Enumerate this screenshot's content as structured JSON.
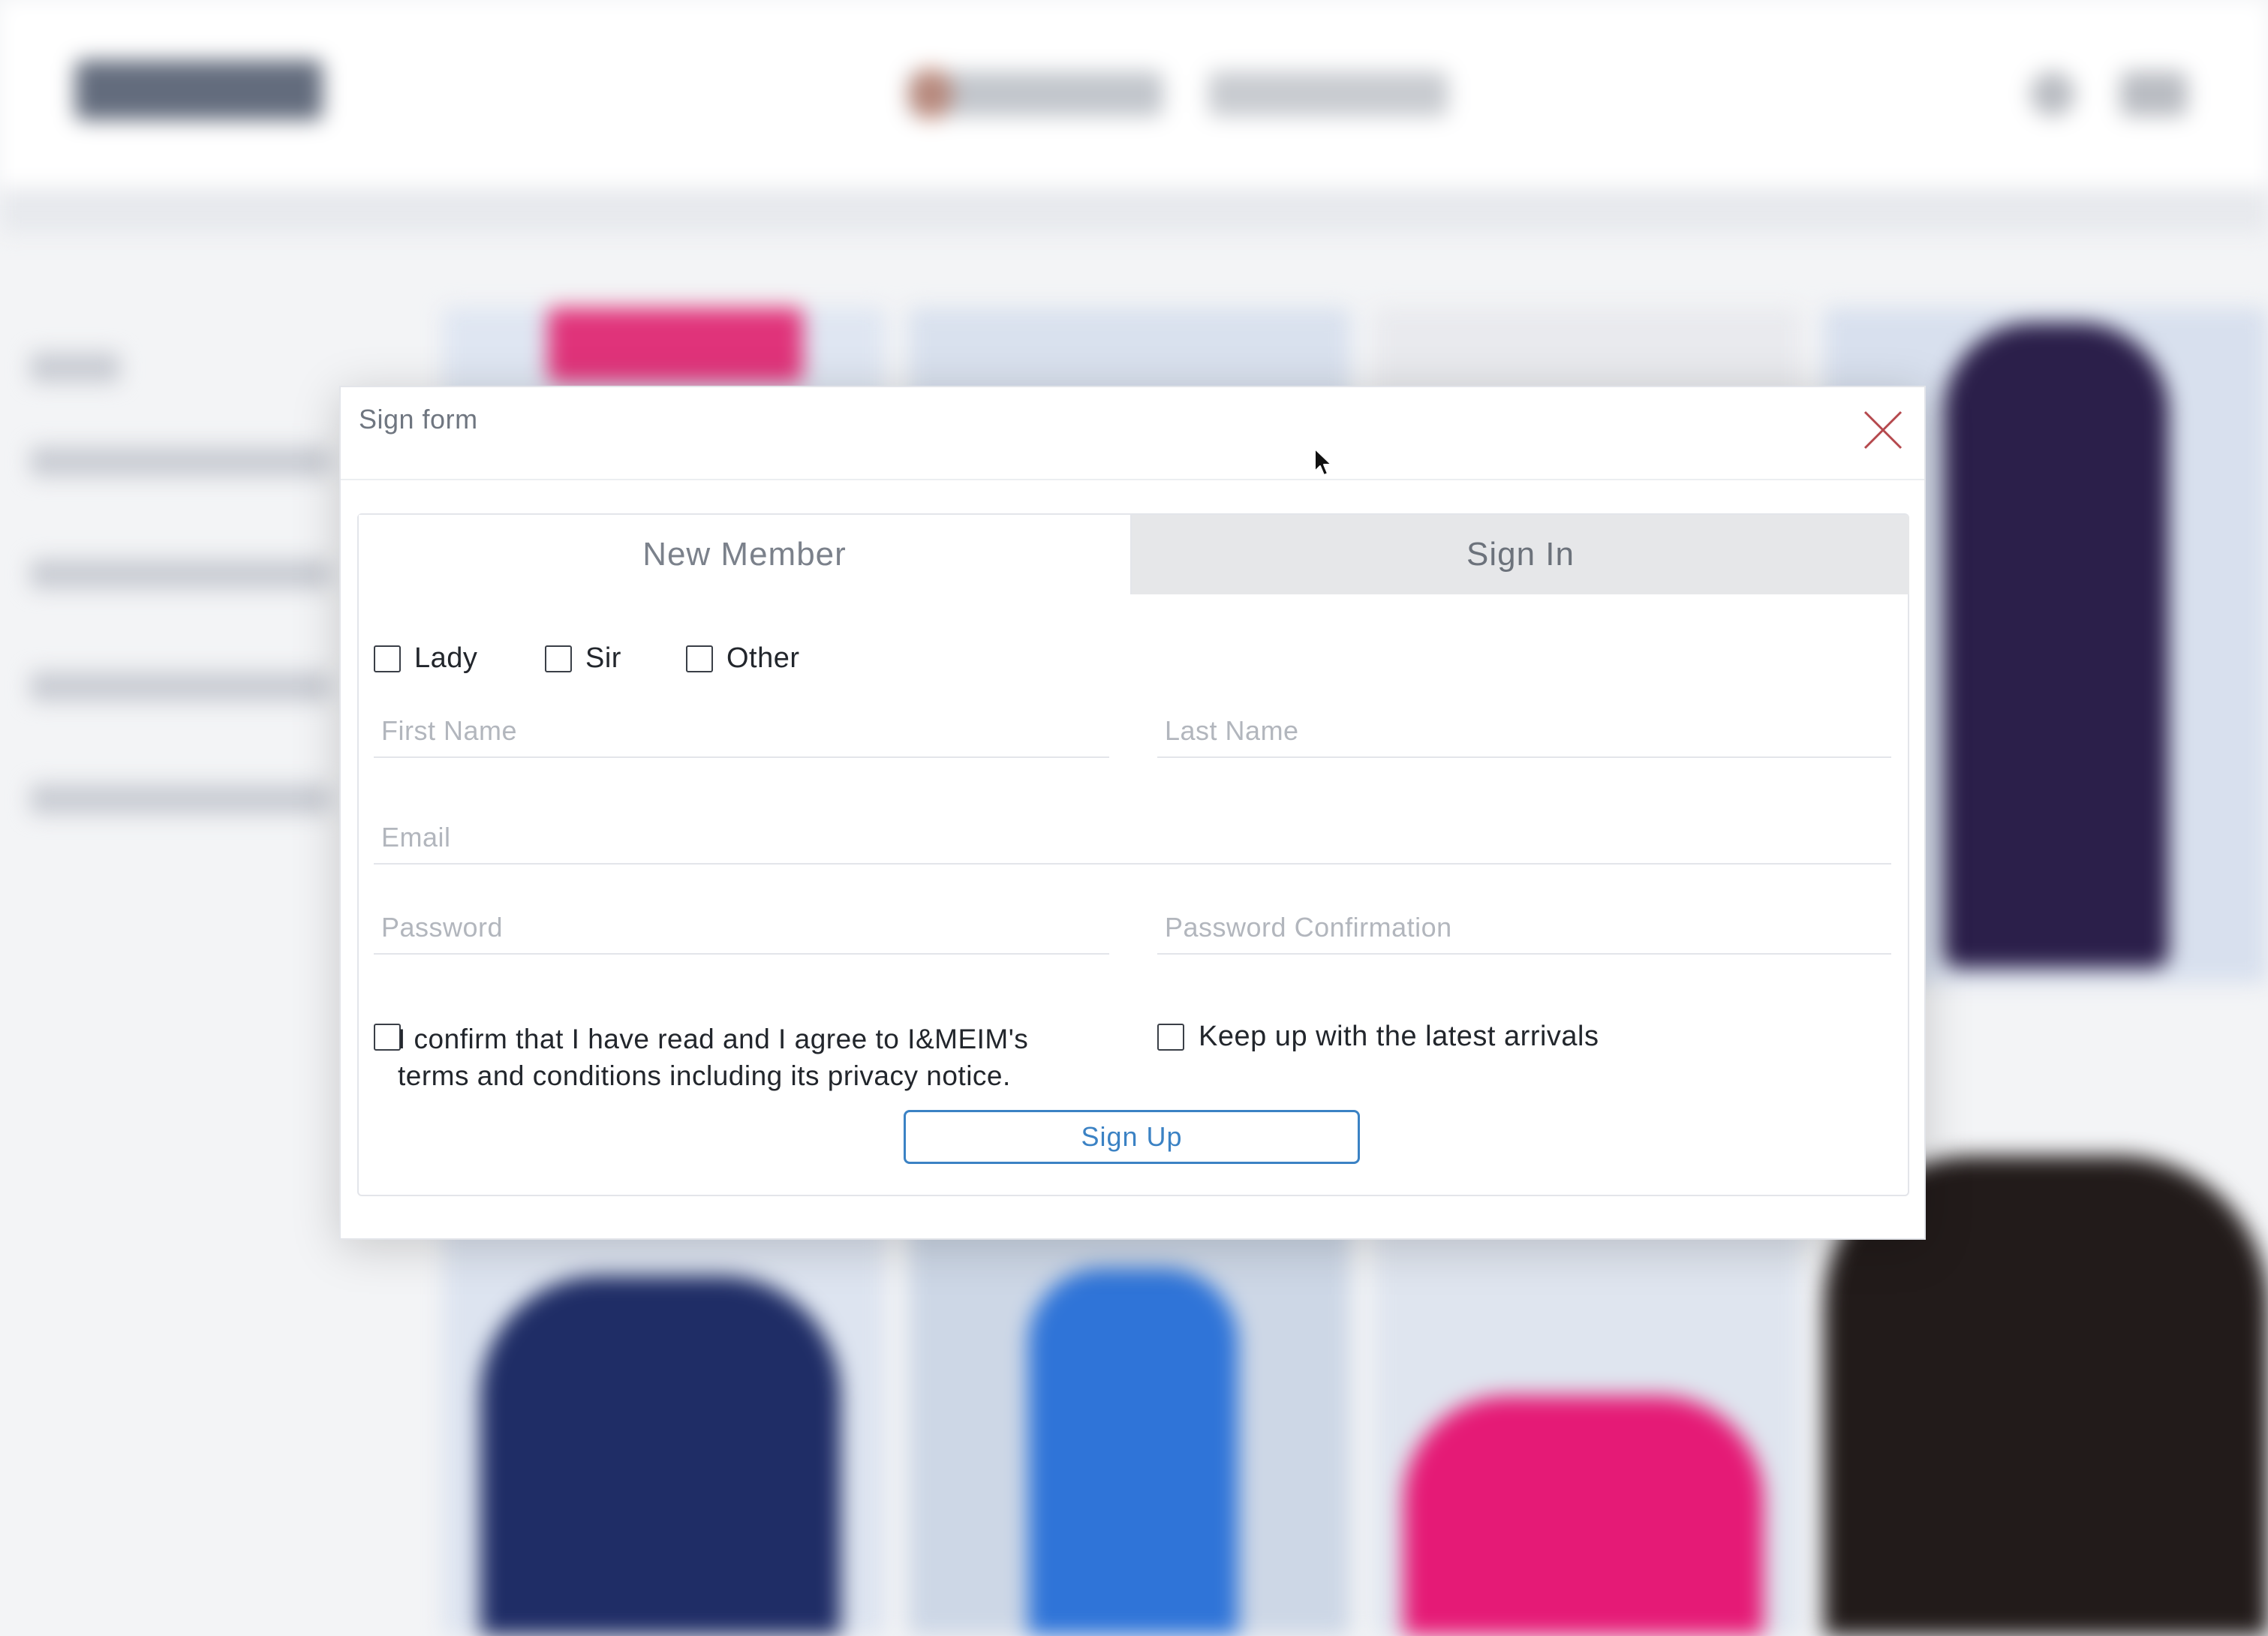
{
  "dialog": {
    "title": "Sign form",
    "close_color": "#b5484d"
  },
  "tabs": [
    {
      "label": "New Member",
      "active": true
    },
    {
      "label": "Sign In",
      "active": false
    }
  ],
  "salutation": {
    "options": [
      {
        "label": "Lady",
        "checked": false
      },
      {
        "label": "Sir",
        "checked": false
      },
      {
        "label": "Other",
        "checked": false
      }
    ]
  },
  "fields": {
    "first_name": {
      "placeholder": "First Name",
      "value": ""
    },
    "last_name": {
      "placeholder": "Last Name",
      "value": ""
    },
    "email": {
      "placeholder": "Email",
      "value": ""
    },
    "password": {
      "placeholder": "Password",
      "value": ""
    },
    "password_confirmation": {
      "placeholder": "Password Confirmation",
      "value": ""
    }
  },
  "consent": {
    "terms_label": "I confirm that I have read and I agree to I&MEIM's terms and conditions including its privacy notice.",
    "terms_checked": false,
    "newsletter_label": "Keep up with the latest arrivals",
    "newsletter_checked": false
  },
  "actions": {
    "signup_label": "Sign Up",
    "accent_color": "#3b82c4"
  }
}
